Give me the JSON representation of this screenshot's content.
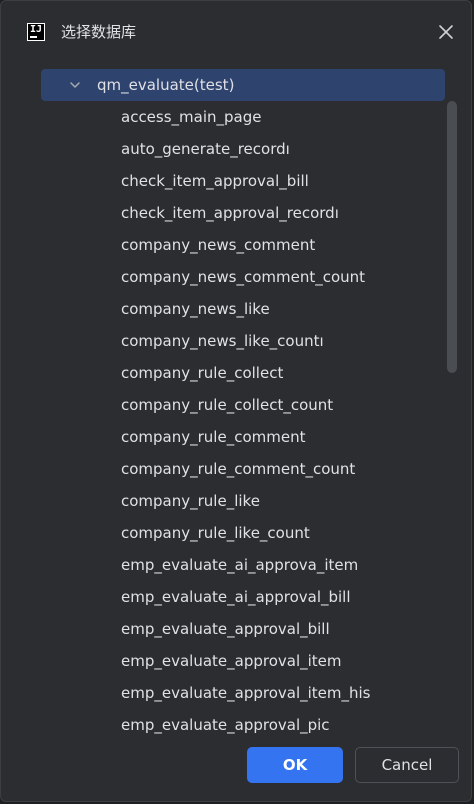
{
  "window": {
    "title": "选择数据库",
    "accent_color": "#3574f0",
    "selection_color": "#2e436e"
  },
  "tree": {
    "root_label": "qm_evaluate(test)",
    "items": [
      "access_main_page",
      "auto_generate_recordı",
      "check_item_approval_bill",
      "check_item_approval_recordı",
      "company_news_comment",
      "company_news_comment_count",
      "company_news_like",
      "company_news_like_countı",
      "company_rule_collect",
      "company_rule_collect_count",
      "company_rule_comment",
      "company_rule_comment_count",
      "company_rule_like",
      "company_rule_like_count",
      "emp_evaluate_ai_approva_item",
      "emp_evaluate_ai_approval_bill",
      "emp_evaluate_approval_bill",
      "emp_evaluate_approval_item",
      "emp_evaluate_approval_item_his",
      "emp_evaluate_approval_pic"
    ]
  },
  "footer": {
    "ok_label": "OK",
    "cancel_label": "Cancel"
  }
}
